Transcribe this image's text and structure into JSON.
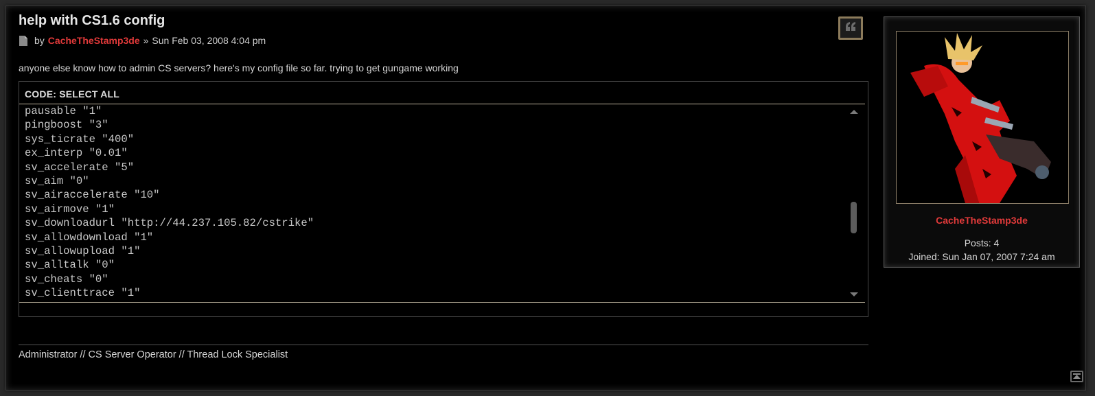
{
  "post": {
    "title": "help with CS1.6 config",
    "by_label": "by",
    "author": "CacheTheStamp3de",
    "separator": "»",
    "date": "Sun Feb 03, 2008 4:04 pm",
    "body": "anyone else know how to admin CS servers? here's my config file so far. trying to get gungame working"
  },
  "code": {
    "header": "CODE: SELECT ALL",
    "lines": [
      "pausable \"1\"",
      "pingboost \"3\"",
      "sys_ticrate \"400\"",
      "ex_interp \"0.01\"",
      "sv_accelerate \"5\"",
      "sv_aim \"0\"",
      "sv_airaccelerate \"10\"",
      "sv_airmove \"1\"",
      "sv_downloadurl \"http://44.237.105.82/cstrike\"",
      "sv_allowdownload \"1\"",
      "sv_allowupload \"1\"",
      "sv_alltalk \"0\"",
      "sv_cheats \"0\"",
      "sv_clienttrace \"1\""
    ]
  },
  "signature": "Administrator // CS Server Operator // Thread Lock Specialist",
  "profile": {
    "name": "CacheTheStamp3de",
    "posts": "Posts: 4",
    "joined": "Joined: Sun Jan 07, 2007 7:24 am"
  },
  "colors": {
    "accent_red": "#e23a3a",
    "quote_border": "#8c7b5b"
  },
  "icons": {
    "post": "post-icon",
    "quote": "quote-icon",
    "top": "back-to-top-icon"
  }
}
